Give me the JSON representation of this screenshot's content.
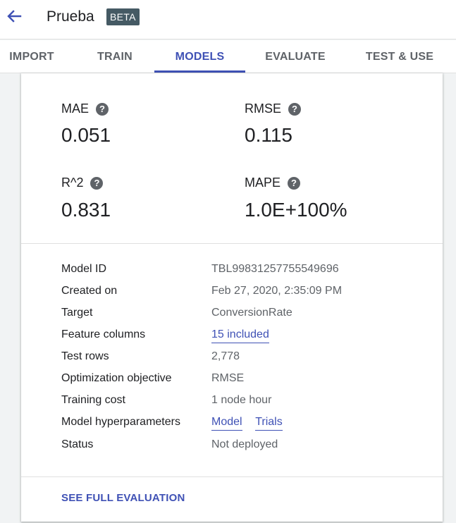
{
  "header": {
    "title": "Prueba",
    "badge": "BETA",
    "accent_color": "#3f51b5",
    "back_icon": "arrow-back-icon"
  },
  "tabs": [
    {
      "label": "IMPORT",
      "active": false
    },
    {
      "label": "TRAIN",
      "active": false
    },
    {
      "label": "MODELS",
      "active": true
    },
    {
      "label": "EVALUATE",
      "active": false
    },
    {
      "label": "TEST & USE",
      "active": false
    }
  ],
  "metrics": {
    "mae": {
      "label": "MAE",
      "value": "0.051"
    },
    "rmse": {
      "label": "RMSE",
      "value": "0.115"
    },
    "r2": {
      "label": "R^2",
      "value": "0.831"
    },
    "mape": {
      "label": "MAPE",
      "value": "1.0E+100%"
    },
    "help_icon": "help-circle-icon"
  },
  "details": {
    "model_id": {
      "label": "Model ID",
      "value": "TBL998312577555496 96"
    },
    "created_on": {
      "label": "Created on",
      "value": "Feb 27, 2020, 2:35:09 PM"
    },
    "target": {
      "label": "Target",
      "value": "ConversionRate"
    },
    "feature_columns": {
      "label": "Feature columns",
      "value": "15 included"
    },
    "test_rows": {
      "label": "Test rows",
      "value": "2,778"
    },
    "optimization_objective": {
      "label": "Optimization objective",
      "value": "RMSE"
    },
    "training_cost": {
      "label": "Training cost",
      "value": "1 node hour"
    },
    "model_hyperparameters": {
      "label": "Model hyperparameters",
      "model_link": "Model",
      "trials_link": "Trials"
    },
    "status": {
      "label": "Status",
      "value": "Not deployed"
    }
  },
  "footer": {
    "see_full_evaluation": "SEE FULL EVALUATION"
  }
}
